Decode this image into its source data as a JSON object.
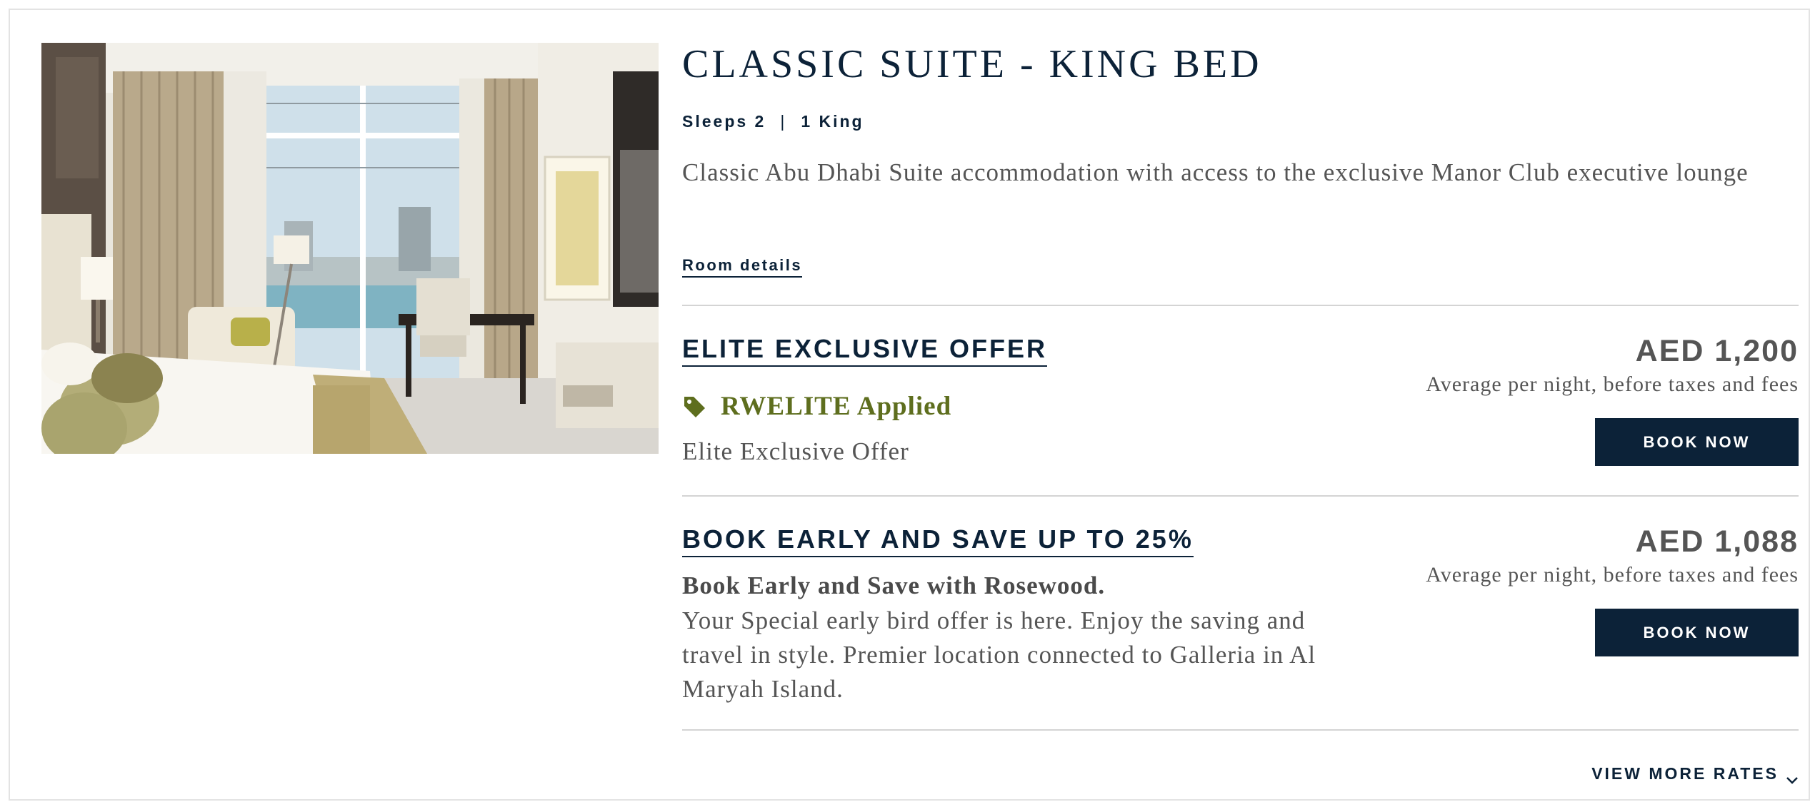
{
  "room": {
    "title": "CLASSIC SUITE - KING BED",
    "sleeps": "Sleeps 2",
    "separator": "|",
    "bed": "1 King",
    "description": "Classic Abu Dhabi Suite accommodation with access to the exclusive Manor Club executive lounge",
    "details_link": "Room details",
    "image_icon": "hotel-room-photo"
  },
  "rates": [
    {
      "title": "ELITE EXCLUSIVE OFFER",
      "promo_icon": "tag-icon",
      "promo_text": "RWELITE Applied",
      "description": "Elite Exclusive Offer",
      "price": "AED 1,200",
      "price_note": "Average per night, before taxes and fees",
      "book_label": "BOOK NOW"
    },
    {
      "title": "BOOK EARLY AND SAVE UP TO 25%",
      "description_bold": "Book Early and Save with Rosewood.",
      "description": "Your Special early bird offer is here. Enjoy the saving and travel in style. Premier location connected to Galleria in Al Maryah Island.",
      "price": "AED 1,088",
      "price_note": "Average per night, before taxes and fees",
      "book_label": "BOOK NOW"
    }
  ],
  "view_more": {
    "label": "VIEW MORE RATES",
    "icon": "chevron-down-icon"
  },
  "colors": {
    "navy": "#0c2238",
    "promo_green": "#5e6e1e",
    "text_gray": "#555555",
    "divider": "#d4d4d4"
  }
}
